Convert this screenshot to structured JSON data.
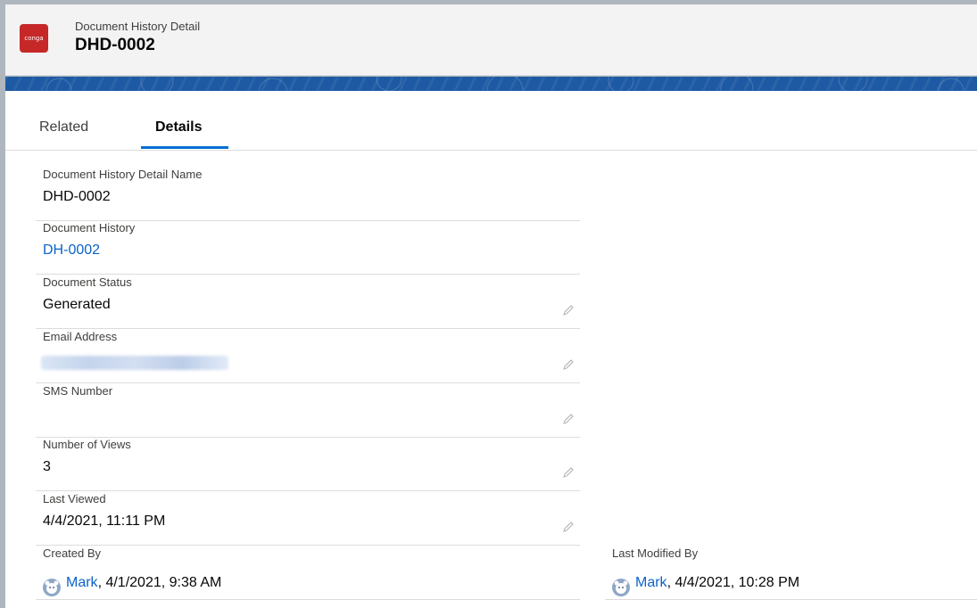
{
  "header": {
    "logo_text": "conga",
    "object_label": "Document History Detail",
    "record_name": "DHD-0002"
  },
  "tabs": [
    {
      "label": "Related",
      "active": false
    },
    {
      "label": "Details",
      "active": true
    }
  ],
  "fields": {
    "detail_name": {
      "label": "Document History Detail Name",
      "value": "DHD-0002"
    },
    "document_history": {
      "label": "Document History",
      "value": "DH-0002"
    },
    "document_status": {
      "label": "Document Status",
      "value": "Generated"
    },
    "email_address": {
      "label": "Email Address",
      "value": ""
    },
    "sms_number": {
      "label": "SMS Number",
      "value": ""
    },
    "number_of_views": {
      "label": "Number of Views",
      "value": "3"
    },
    "last_viewed": {
      "label": "Last Viewed",
      "value": "4/4/2021, 11:11 PM"
    }
  },
  "created_by": {
    "label": "Created By",
    "user": "Mark",
    "timestamp": ", 4/1/2021, 9:38 AM"
  },
  "last_modified_by": {
    "label": "Last Modified By",
    "user": "Mark",
    "timestamp": ", 4/4/2021, 10:28 PM"
  },
  "icons": {
    "edit": "pencil-icon",
    "avatar": "user-avatar-icon"
  },
  "colors": {
    "accent": "#0070d2",
    "link": "#0b63c7",
    "banner": "#1e5aa3",
    "logo": "#c62828"
  }
}
